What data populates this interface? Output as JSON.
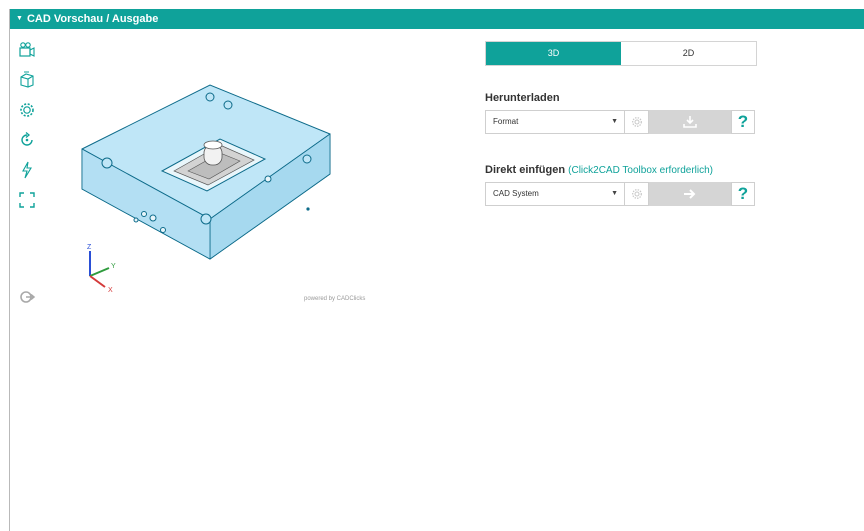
{
  "header": {
    "title": "CAD Vorschau / Ausgabe",
    "caret_icon": "caret-down-icon"
  },
  "toolbar": {
    "icons": [
      "camera-views-icon",
      "box-view-icon",
      "settings-gear-icon",
      "rotate-icon",
      "lightning-icon",
      "fullscreen-icon",
      "reset-view-icon"
    ]
  },
  "viewer": {
    "powered_by": "powered by CADClicks",
    "axes": {
      "z": "Z",
      "y": "Y",
      "x": "X"
    }
  },
  "view_toggle": {
    "options": [
      "3D",
      "2D"
    ],
    "active": "3D"
  },
  "download": {
    "title": "Herunterladen",
    "select_value": "Format",
    "help_label": "?"
  },
  "insert": {
    "title": "Direkt einfügen",
    "hint": "(Click2CAD Toolbox erforderlich)",
    "select_value": "CAD System",
    "help_label": "?"
  },
  "colors": {
    "accent": "#0fa29a",
    "disabled_button": "#d5d5d5",
    "part_fill": "#bfe6f7"
  }
}
